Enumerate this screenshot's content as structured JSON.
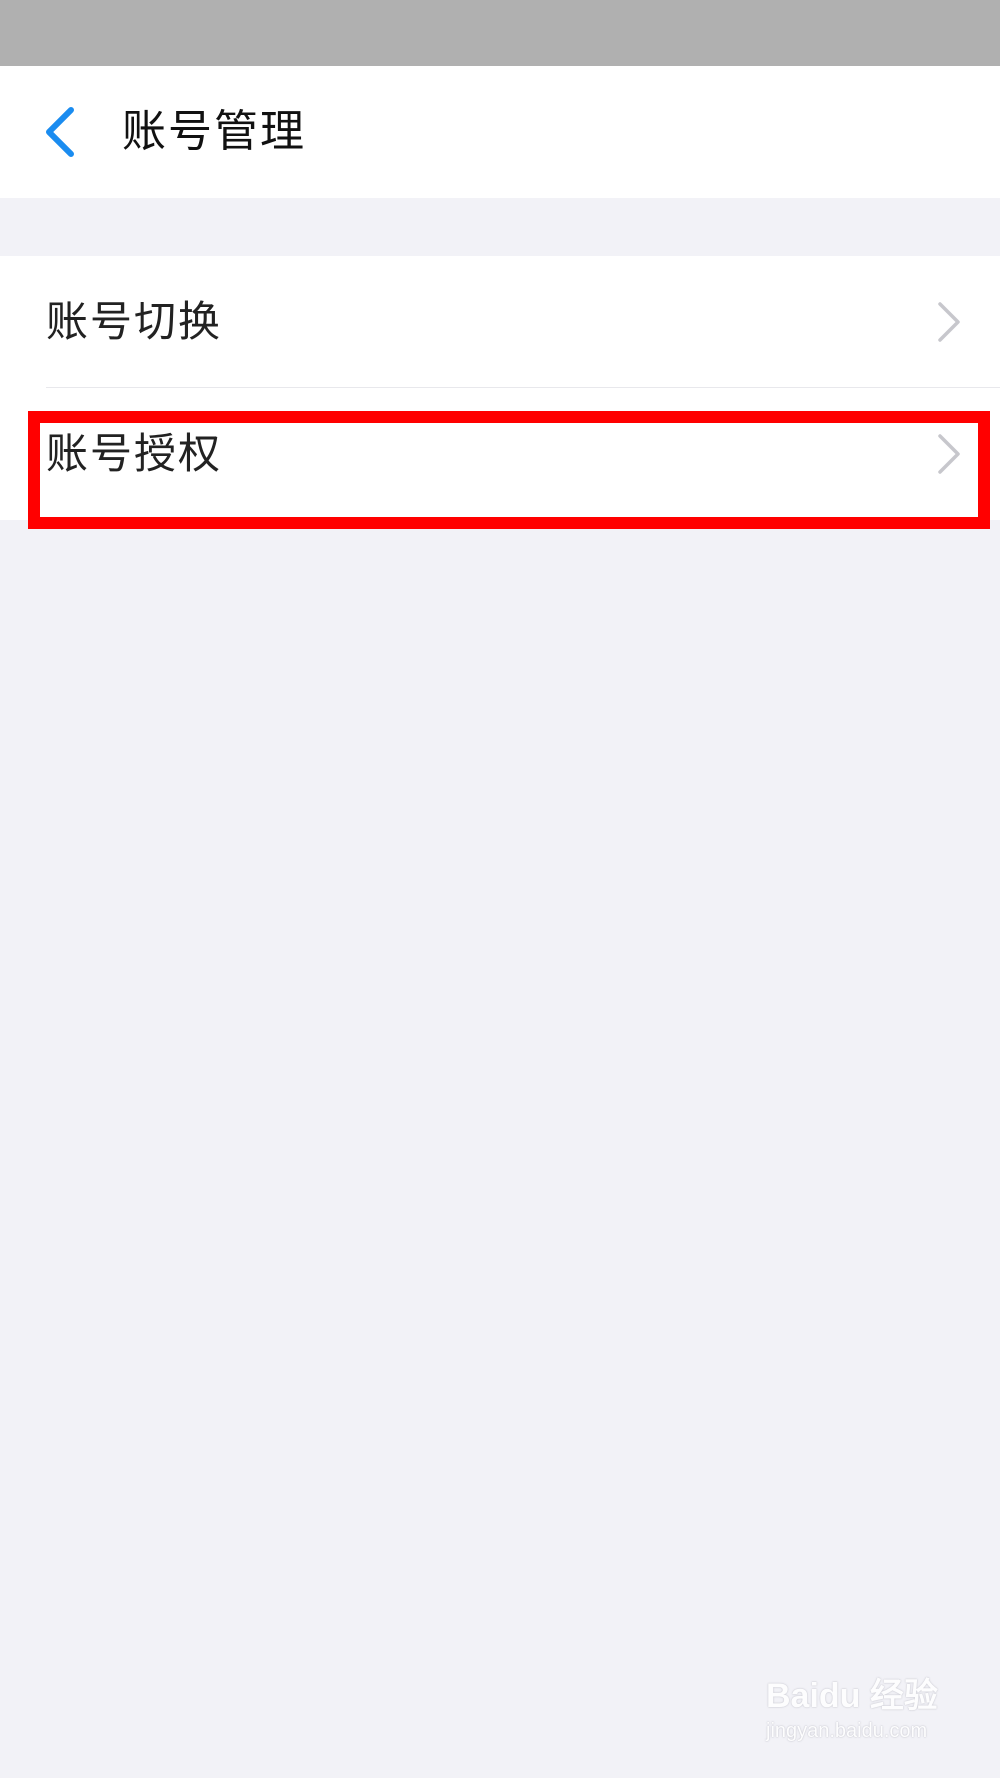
{
  "header": {
    "title": "账号管理",
    "back_icon": "chevron-left-icon",
    "accent": "#1a8cf0"
  },
  "menu": {
    "items": [
      {
        "label": "账号切换",
        "icon": "chevron-right-icon"
      },
      {
        "label": "账号授权",
        "icon": "chevron-right-icon",
        "highlighted": true
      }
    ]
  },
  "annotation": {
    "highlight_color": "#ff0000"
  },
  "watermark": {
    "logo": "Baidu 经验",
    "url": "jingyan.baidu.com"
  }
}
